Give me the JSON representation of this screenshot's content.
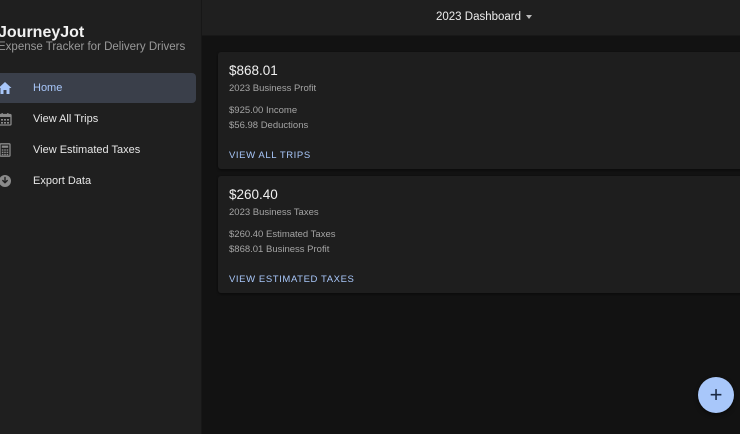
{
  "app": {
    "title": "JourneyJot",
    "subtitle": "Expense Tracker for Delivery Drivers"
  },
  "sidebar": {
    "items": [
      {
        "label": "Home",
        "icon": "home-icon",
        "active": true
      },
      {
        "label": "View All Trips",
        "icon": "calendar-icon",
        "active": false
      },
      {
        "label": "View Estimated Taxes",
        "icon": "calculator-icon",
        "active": false
      },
      {
        "label": "Export Data",
        "icon": "download-circle-icon",
        "active": false
      }
    ]
  },
  "header": {
    "dashboard_select": "2023 Dashboard"
  },
  "cards": [
    {
      "amount": "$868.01",
      "subtitle": "2023 Business Profit",
      "line1": "$925.00 Income",
      "line2": "$56.98 Deductions",
      "action": "VIEW ALL TRIPS"
    },
    {
      "amount": "$260.40",
      "subtitle": "2023 Business Taxes",
      "line1": "$260.40 Estimated Taxes",
      "line2": "$868.01 Business Profit",
      "action": "VIEW ESTIMATED TAXES"
    }
  ],
  "fab": {
    "icon": "plus-icon",
    "symbol": "+"
  },
  "colors": {
    "accent": "#a8c7fa",
    "sidebar_bg": "#1f1f1f",
    "content_bg": "#121212",
    "card_bg": "#1e1e1e",
    "active_item_bg": "#3a3f4a"
  }
}
